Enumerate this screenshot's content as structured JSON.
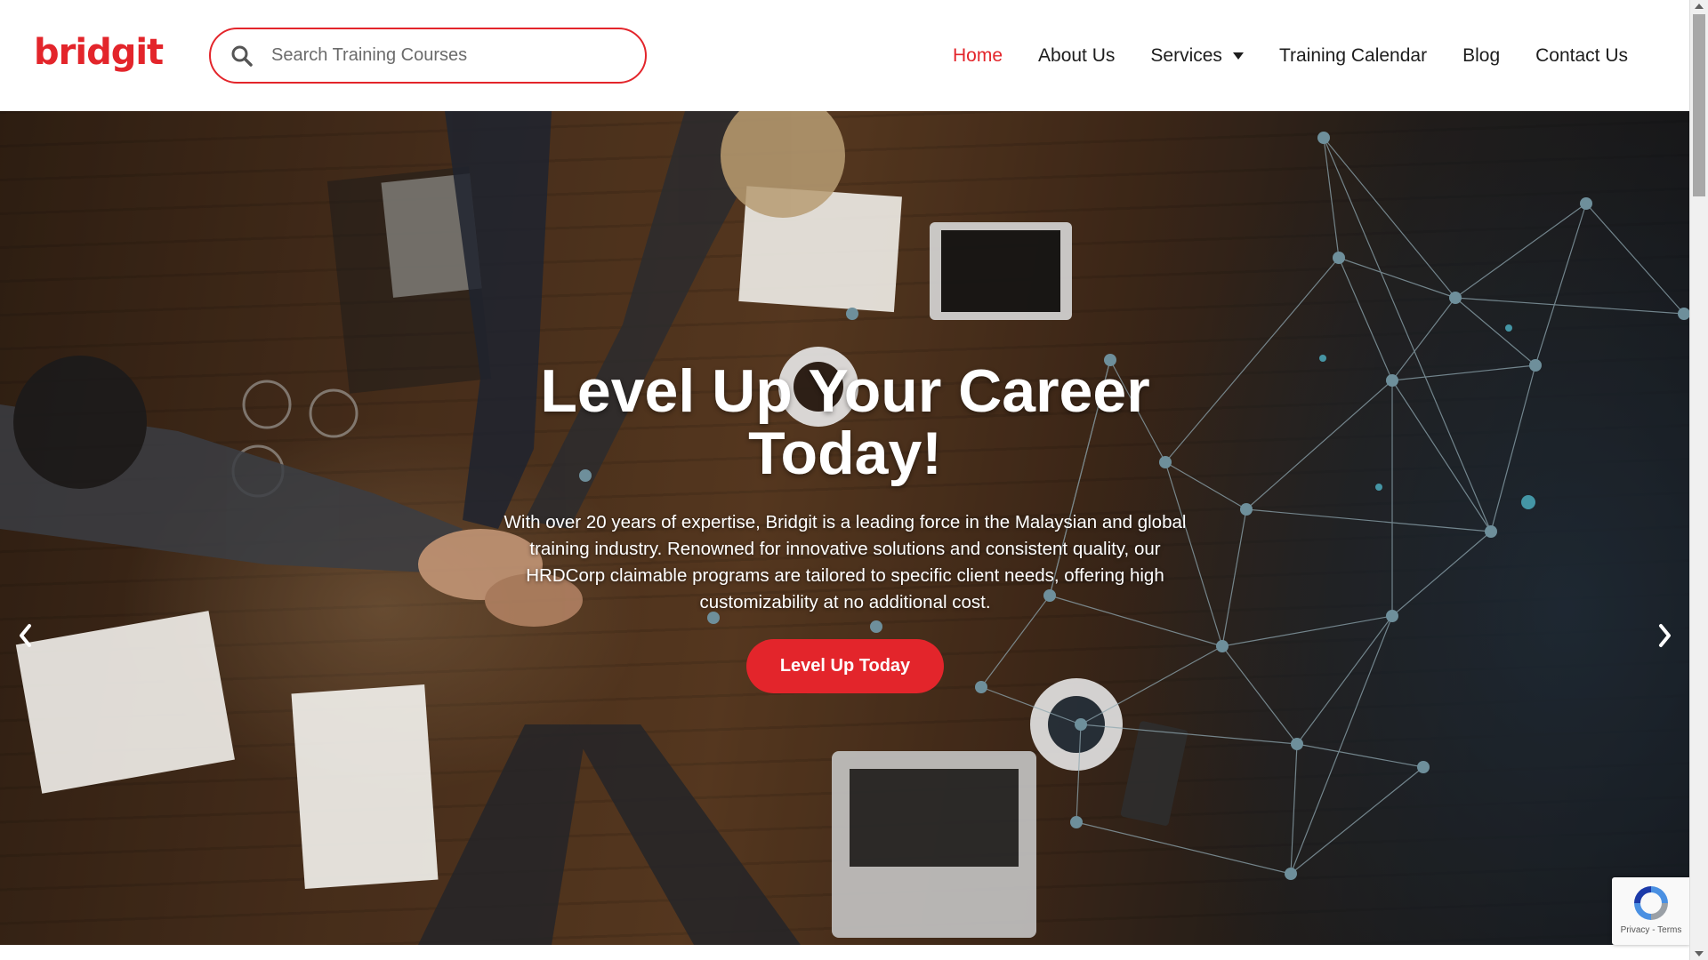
{
  "brand": {
    "logo_text": "bridgit",
    "accent_color": "#e3252b"
  },
  "search": {
    "placeholder": "Search Training Courses",
    "value": "",
    "icon": "search-icon"
  },
  "nav": {
    "items": [
      {
        "label": "Home",
        "active": true
      },
      {
        "label": "About Us",
        "active": false
      },
      {
        "label": "Services",
        "active": false,
        "has_dropdown": true
      },
      {
        "label": "Training Calendar",
        "active": false
      },
      {
        "label": "Blog",
        "active": false
      },
      {
        "label": "Contact Us",
        "active": false
      }
    ]
  },
  "hero": {
    "title_line1": "Level Up Your Career",
    "title_line2": "Today!",
    "description": "With over 20 years of expertise, Bridgit is a leading force in the Malaysian and global training industry. Renowned for innovative solutions and consistent quality, our HRDCorp claimable programs are tailored to specific client needs, offering high customizability at no additional cost.",
    "cta_label": "Level Up Today",
    "prev_icon": "chevron-left-icon",
    "next_icon": "chevron-right-icon"
  },
  "recaptcha": {
    "text": "Privacy - Terms"
  }
}
